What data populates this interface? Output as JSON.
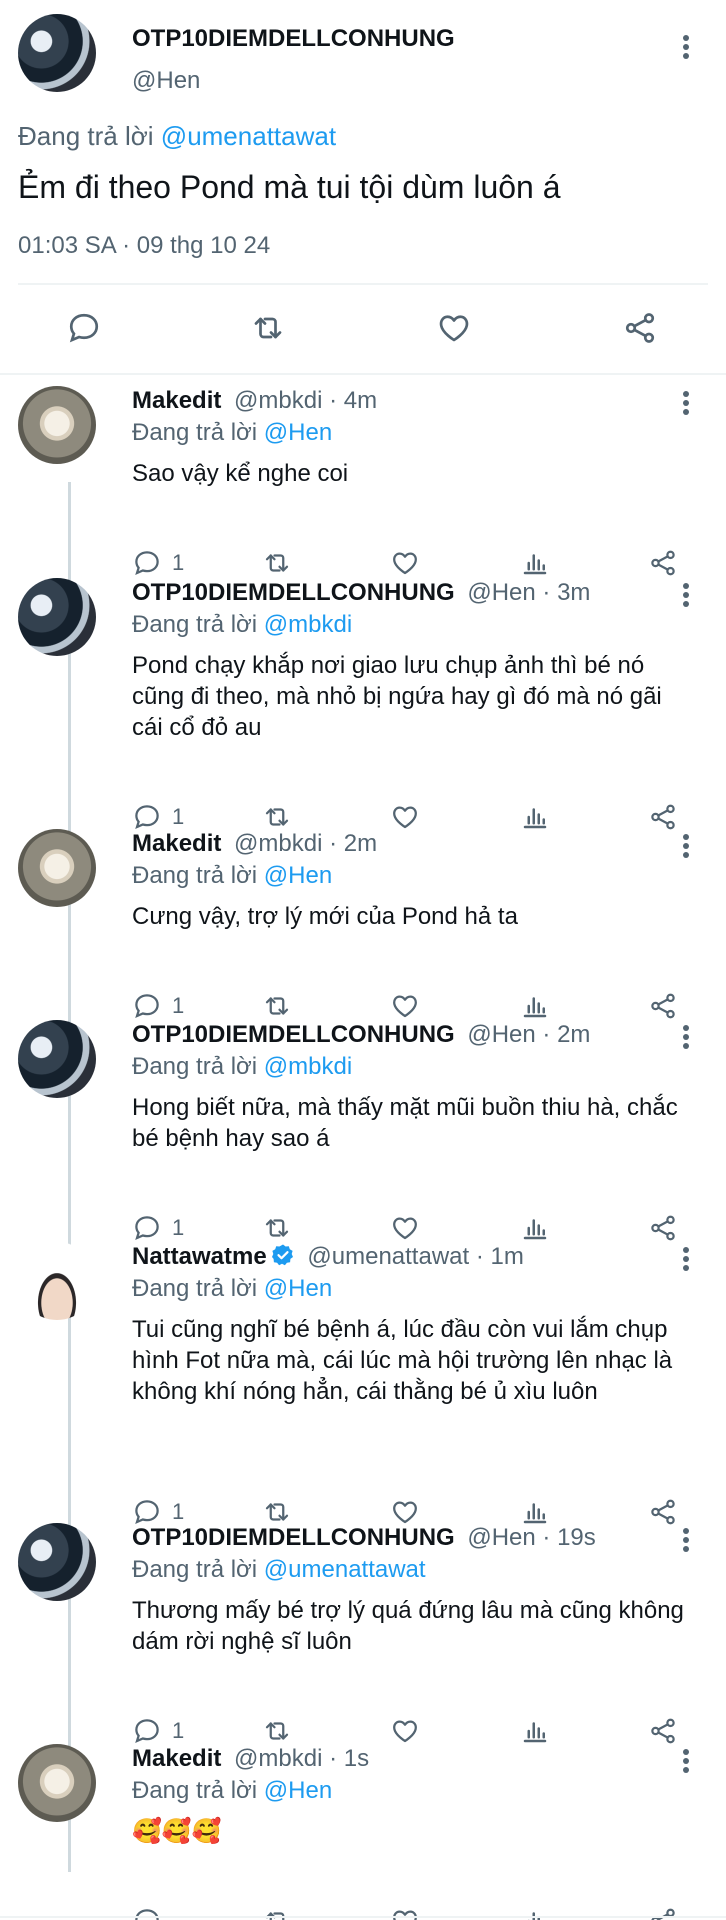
{
  "main_tweet": {
    "display_name": "OTP10DIEMDELLCONHUNG",
    "handle": "@Hen",
    "replying_label": "Đang trả lời",
    "replying_to": "@umenattawat",
    "text": "Ẻm đi theo Pond mà tui tội dùm luôn á",
    "timestamp": "01:03 SA · 09 thg 10 24",
    "icons": [
      "reply-icon",
      "retweet-icon",
      "like-icon",
      "share-icon"
    ]
  },
  "replies": [
    {
      "display_name": "Makedit",
      "handle": "@mbkdi",
      "time": "· 4m",
      "replying_label": "Đang trả lời",
      "replying_to": "@Hen",
      "text": "Sao vậy kể nghe coi",
      "reply_count": "1"
    },
    {
      "display_name": "OTP10DIEMDELLCONHUNG",
      "handle": "@Hen",
      "time": "· 3m",
      "replying_label": "Đang trả lời",
      "replying_to": "@mbkdi",
      "text": "Pond chạy khắp nơi giao lưu chụp ảnh thì bé nó cũng đi theo, mà nhỏ bị ngứa hay gì đó mà nó gãi cái cổ đỏ au",
      "reply_count": "1"
    },
    {
      "display_name": "Makedit",
      "handle": "@mbkdi",
      "time": "· 2m",
      "replying_label": "Đang trả lời",
      "replying_to": "@Hen",
      "text": "Cưng vậy, trợ lý mới của Pond hả ta",
      "reply_count": "1"
    },
    {
      "display_name": "OTP10DIEMDELLCONHUNG",
      "handle": "@Hen",
      "time": "· 2m",
      "replying_label": "Đang trả lời",
      "replying_to": "@mbkdi",
      "text": "Hong biết nữa, mà thấy mặt mũi buồn thiu hà, chắc bé bệnh hay sao á",
      "reply_count": "1"
    },
    {
      "display_name": "Nattawatme",
      "handle": "@umenattawat",
      "time": "· 1m",
      "replying_label": "Đang trả lời",
      "replying_to": "@Hen",
      "text": "Tui cũng nghĩ bé bệnh á, lúc đầu còn vui lắm chụp hình Fot nữa mà, cái lúc mà hội trường lên nhạc là không khí nóng hẳn, cái thằng bé ủ xìu luôn",
      "reply_count": "1"
    },
    {
      "display_name": "OTP10DIEMDELLCONHUNG",
      "handle": "@Hen",
      "time": "· 19s",
      "replying_label": "Đang trả lời",
      "replying_to": "@umenattawat",
      "text": "Thương mấy bé trợ lý quá đứng lâu mà cũng không dám rời nghệ sĩ luôn",
      "reply_count": "1"
    },
    {
      "display_name": "Makedit",
      "handle": "@mbkdi",
      "time": "· 1s",
      "replying_label": "Đang trả lời",
      "replying_to": "@Hen",
      "text": "🥰🥰🥰",
      "reply_count": ""
    }
  ],
  "colors": {
    "accent": "#1d9bf0",
    "muted": "#536471",
    "verified": "#1d9bf0",
    "divider": "#eff3f4"
  }
}
